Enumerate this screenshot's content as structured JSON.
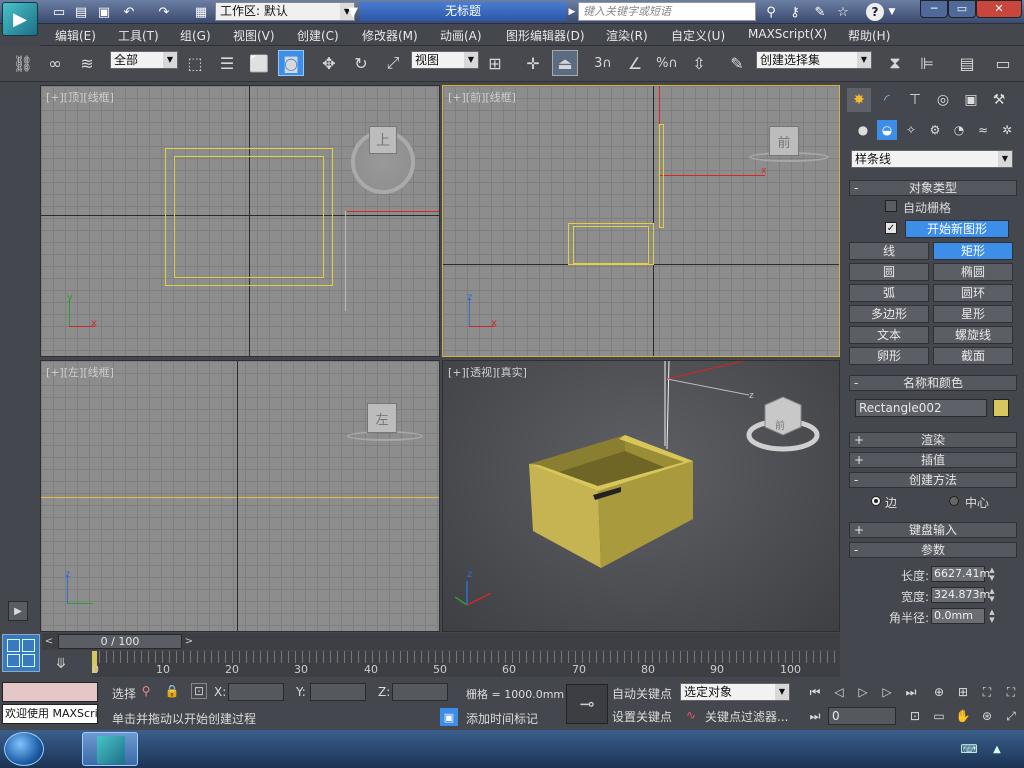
{
  "app": {
    "logo_text": "▶",
    "workspace_label": "工作区: 默认",
    "title": "无标题",
    "search_placeholder": "键入关键字或短语"
  },
  "window_controls": [
    "─",
    "▭",
    "✕"
  ],
  "menus": [
    "编辑(E)",
    "工具(T)",
    "组(G)",
    "视图(V)",
    "创建(C)",
    "修改器(M)",
    "动画(A)",
    "图形编辑器(D)",
    "渲染(R)",
    "自定义(U)",
    "MAXScript(X)",
    "帮助(H)"
  ],
  "toolbar": {
    "filter_select": "全部",
    "coord_select": "视图",
    "named_set": "创建选择集",
    "snap_label": "3",
    "percent_label": "%"
  },
  "viewports": {
    "top": {
      "label": "[+][顶][线框]",
      "cube": "上"
    },
    "front": {
      "label": "[+][前][线框]",
      "cube": "前"
    },
    "left": {
      "label": "[+][左][线框]",
      "cube": "左"
    },
    "persp": {
      "label": "[+][透视][真实]",
      "cube_front": "前"
    }
  },
  "axes": {
    "x": "x",
    "y": "y",
    "z": "z"
  },
  "panel": {
    "category_select": "样条线",
    "object_type": {
      "title": "对象类型",
      "autogrid": "自动栅格",
      "start_new_shape": "开始新图形",
      "buttons": [
        "线",
        "矩形",
        "圆",
        "椭圆",
        "弧",
        "圆环",
        "多边形",
        "星形",
        "文本",
        "螺旋线",
        "卵形",
        "截面"
      ],
      "active": "矩形"
    },
    "name_color": {
      "title": "名称和颜色",
      "name": "Rectangle002",
      "color": "#d8c65e"
    },
    "render": "渲染",
    "interpolation": "插值",
    "creation_method": {
      "title": "创建方法",
      "options": [
        "边",
        "中心"
      ],
      "selected": "边"
    },
    "keyboard_entry": "键盘输入",
    "params": {
      "title": "参数",
      "length_label": "长度:",
      "length": "6627.41m",
      "width_label": "宽度:",
      "width": "324.873m",
      "radius_label": "角半径:",
      "radius": "0.0mm"
    }
  },
  "timeline": {
    "frame": "0 / 100",
    "ticks": [
      "10",
      "20",
      "30",
      "40",
      "50",
      "60",
      "70",
      "80",
      "90",
      "100"
    ],
    "ruler_start": "0"
  },
  "status": {
    "welcome": "欢迎使用 MAXScri",
    "select_label": "选择",
    "x_label": "X:",
    "y_label": "Y:",
    "z_label": "Z:",
    "grid": "栅格 = 1000.0mm",
    "prompt": "单击并拖动以开始创建过程",
    "add_time_tag": "添加时间标记",
    "auto_key": "自动关键点",
    "set_key": "设置关键点",
    "key_mode": "选定对象",
    "key_filters": "关键点过滤器...",
    "frame_field": "0"
  },
  "colors": {
    "selection_yellow": "#c8b23a",
    "active_blue": "#3d8ee8",
    "viewport_bg": "#8d8d8d",
    "box_yellow": "#bfae4a"
  }
}
